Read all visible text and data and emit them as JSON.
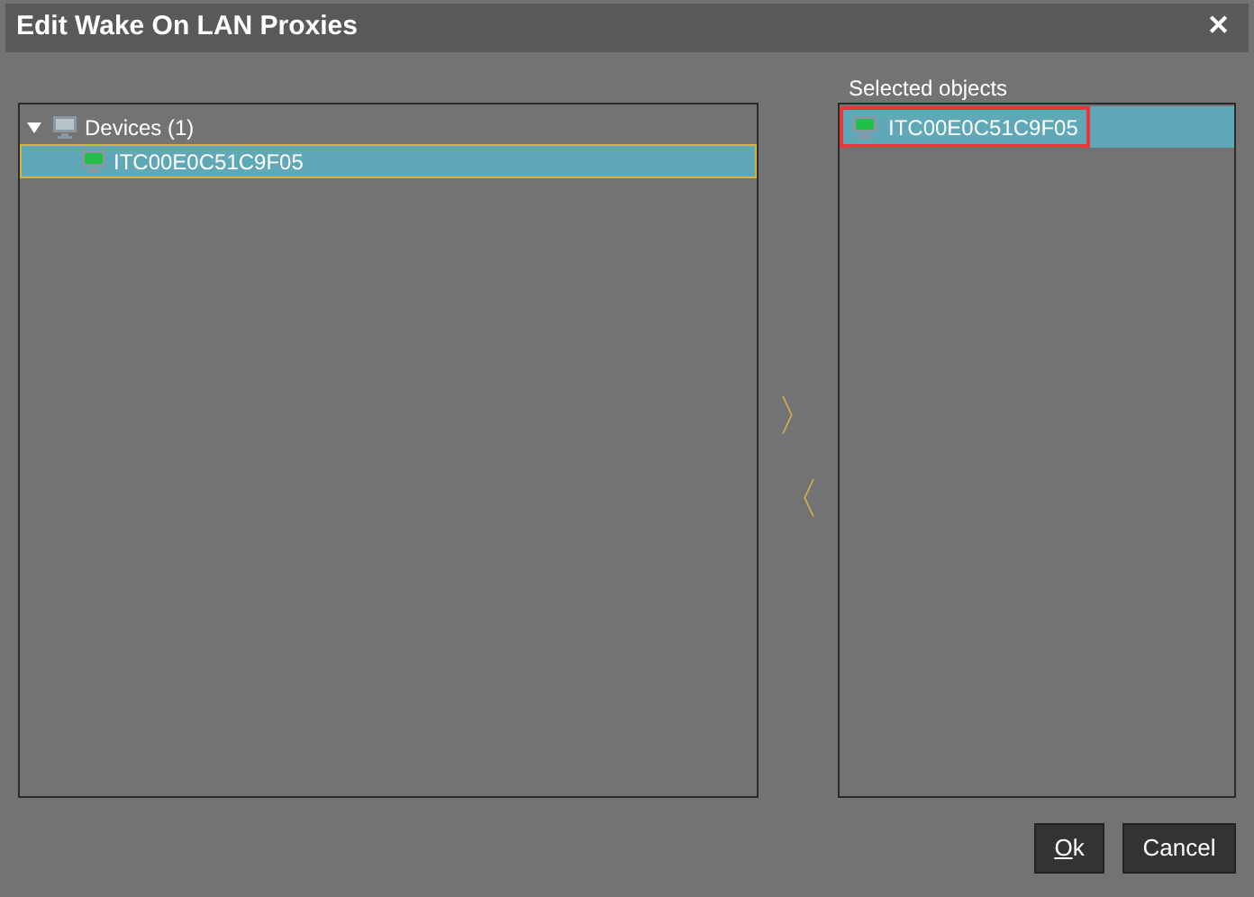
{
  "window": {
    "title": "Edit Wake On LAN Proxies",
    "close": "✕"
  },
  "tree": [
    {
      "label": "Devices (1)",
      "expanded": true,
      "selected": false,
      "children": [
        {
          "label": "ITC00E0C51C9F05",
          "selected": true
        }
      ]
    }
  ],
  "arrows": [
    {
      "glyph": "〉"
    },
    {
      "glyph": "〈"
    }
  ],
  "selected_objects": {
    "label": "Selected objects",
    "items": [
      {
        "label": "ITC00E0C51C9F05",
        "selected": true
      }
    ]
  },
  "buttons": [
    {
      "label": "Ok",
      "mnemonic": true
    },
    {
      "label": "Cancel",
      "mnemonic": false
    }
  ]
}
